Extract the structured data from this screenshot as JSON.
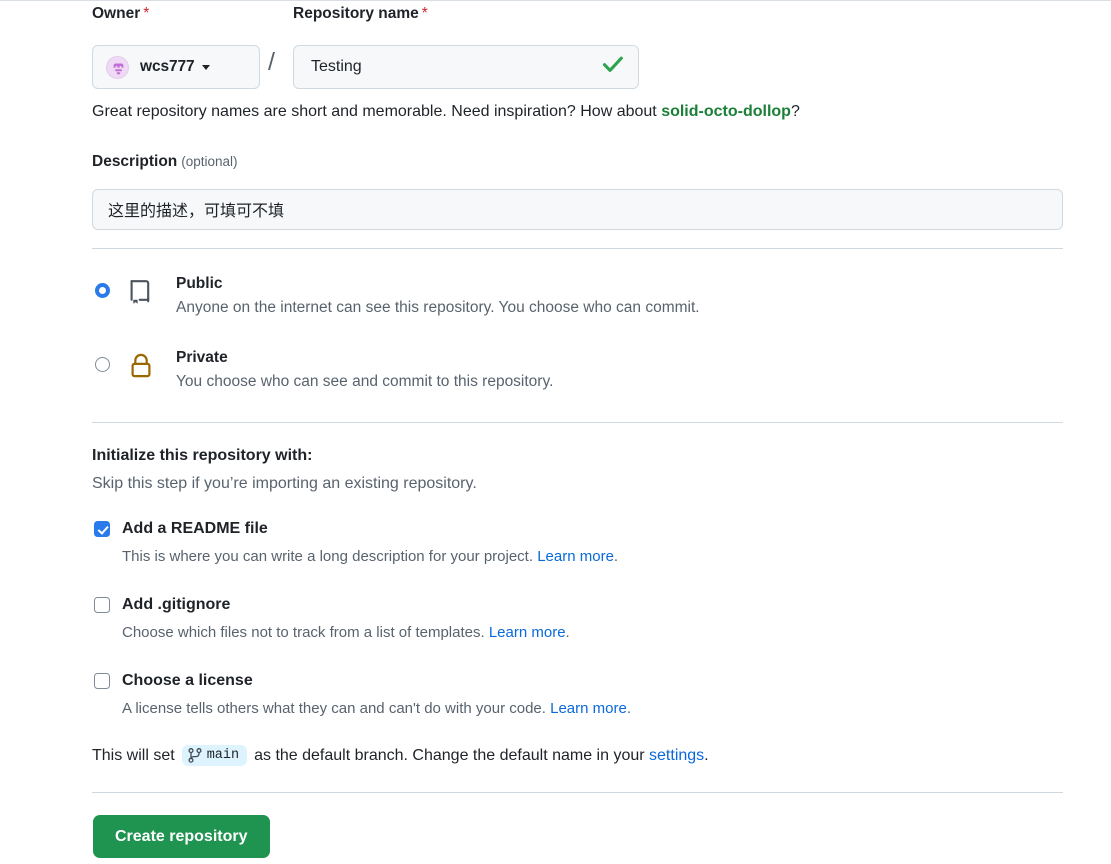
{
  "form": {
    "owner": {
      "label": "Owner",
      "required_mark": "*",
      "selected": "wcs777",
      "avatar_icon": "user-avatar-identicon",
      "caret_icon": "chevron-down-icon"
    },
    "separator": "/",
    "repository_name": {
      "label": "Repository name",
      "required_mark": "*",
      "value": "Testing",
      "placeholder": "",
      "valid_icon": "check-icon"
    },
    "name_hint": {
      "prefix": "Great repository names are short and memorable. Need inspiration? How about ",
      "suggestion": "solid-octo-dollop",
      "suffix": "?"
    },
    "description": {
      "label": "Description",
      "optional_note": "(optional)",
      "value": "这里的描述，可填可不填",
      "placeholder": ""
    },
    "visibility": {
      "options": [
        {
          "id": "public",
          "title": "Public",
          "description": "Anyone on the internet can see this repository. You choose who can commit.",
          "icon": "repo-book-icon",
          "selected": true
        },
        {
          "id": "private",
          "title": "Private",
          "description": "You choose who can see and commit to this repository.",
          "icon": "lock-icon",
          "selected": false
        }
      ]
    },
    "initialize": {
      "title": "Initialize this repository with:",
      "subtitle": "Skip this step if you’re importing an existing repository.",
      "options": [
        {
          "id": "readme",
          "label": "Add a README file",
          "description": "This is where you can write a long description for your project. ",
          "link_text": "Learn more",
          "trailing": ".",
          "checked": true
        },
        {
          "id": "gitignore",
          "label": "Add .gitignore",
          "description": "Choose which files not to track from a list of templates. ",
          "link_text": "Learn more",
          "trailing": ".",
          "checked": false
        },
        {
          "id": "license",
          "label": "Choose a license",
          "description": "A license tells others what they can and can't do with your code. ",
          "link_text": "Learn more",
          "trailing": ".",
          "checked": false
        }
      ]
    },
    "branch_note": {
      "prefix": "This will set",
      "branch_icon": "git-branch-icon",
      "branch_name": "main",
      "middle": "as the default branch. Change the default name in your",
      "link_text": "settings",
      "suffix": "."
    },
    "submit": {
      "label": "Create repository"
    }
  },
  "colors": {
    "accent_green": "#1f9350",
    "link_blue": "#0969da",
    "suggestion_green": "#1a7f37",
    "required_red": "#cf222e",
    "lock_gold": "#9a6700",
    "branch_badge_bg": "#ddf4ff",
    "input_bg": "#f6f8fa",
    "border": "#d1d9e0",
    "muted_text": "#59636e"
  }
}
